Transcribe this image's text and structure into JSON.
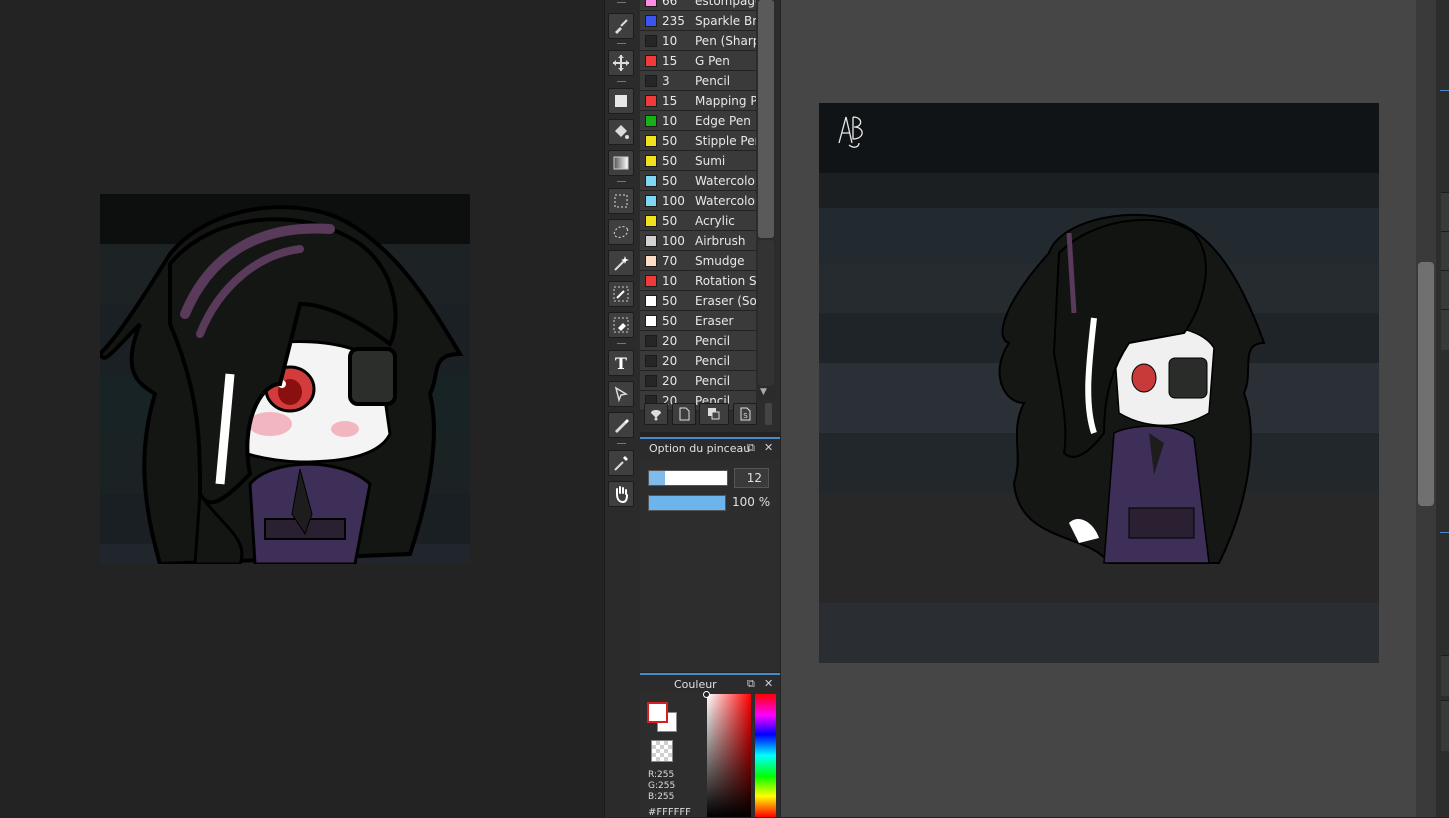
{
  "brushes": [
    {
      "size": "66",
      "name": "estompage",
      "color": "#ff8ce6"
    },
    {
      "size": "235",
      "name": "Sparkle Brush",
      "color": "#3a55f2"
    },
    {
      "size": "10",
      "name": "Pen (Sharp)",
      "color": "#262626"
    },
    {
      "size": "15",
      "name": "G Pen",
      "color": "#f23a3a"
    },
    {
      "size": "3",
      "name": "Pencil",
      "color": "#262626"
    },
    {
      "size": "15",
      "name": "Mapping Pen",
      "color": "#f23a3a"
    },
    {
      "size": "10",
      "name": "Edge Pen",
      "color": "#17b217"
    },
    {
      "size": "50",
      "name": "Stipple Pen",
      "color": "#f2e21e"
    },
    {
      "size": "50",
      "name": "Sumi",
      "color": "#f2e21e"
    },
    {
      "size": "50",
      "name": "Watercolor",
      "color": "#7ed8f4"
    },
    {
      "size": "100",
      "name": "Watercolor",
      "color": "#7ed8f4"
    },
    {
      "size": "50",
      "name": "Acrylic",
      "color": "#f2e21e"
    },
    {
      "size": "100",
      "name": "Airbrush",
      "color": "#d2d2d2"
    },
    {
      "size": "70",
      "name": "Smudge",
      "color": "#ffdcc4"
    },
    {
      "size": "10",
      "name": "Rotation Sym",
      "color": "#f23a3a"
    },
    {
      "size": "50",
      "name": "Eraser (Soft)",
      "color": "#ffffff"
    },
    {
      "size": "50",
      "name": "Eraser",
      "color": "#ffffff"
    },
    {
      "size": "20",
      "name": "Pencil",
      "color": "#262626"
    },
    {
      "size": "20",
      "name": "Pencil",
      "color": "#262626"
    },
    {
      "size": "20",
      "name": "Pencil",
      "color": "#262626"
    },
    {
      "size": "20",
      "name": "Pencil",
      "color": "#262626"
    }
  ],
  "brush_option": {
    "title": "Option du pinceau",
    "size_value": "12",
    "size_fraction": 0.2,
    "opacity_label": "100 %",
    "opacity_fraction": 1.0
  },
  "color_panel": {
    "title": "Couleur",
    "fg_color": "#ffffff",
    "bg_color": "#ffffff",
    "r": "R:255",
    "g": "G:255",
    "b": "B:255",
    "hex": "#FFFFFF"
  },
  "tools": [
    "brush-icon",
    "move-icon",
    "rectangle-icon",
    "fill-bucket-icon",
    "gradient-icon",
    "rect-select-icon",
    "lasso-select-icon",
    "magic-wand-icon",
    "select-pen-icon",
    "select-eraser-icon",
    "text-icon",
    "polygon-select-icon",
    "eraser-pen-icon",
    "eyedropper-icon",
    "hand-icon"
  ],
  "canvas": {
    "signature": "AB"
  },
  "colors": {
    "accent": "#4a8ac8",
    "hair": "#141614",
    "hair_stripe": "#5a3a5a",
    "outfit": "#3e2f58",
    "eye": "#d23c3c",
    "skin": "#ffffff"
  }
}
